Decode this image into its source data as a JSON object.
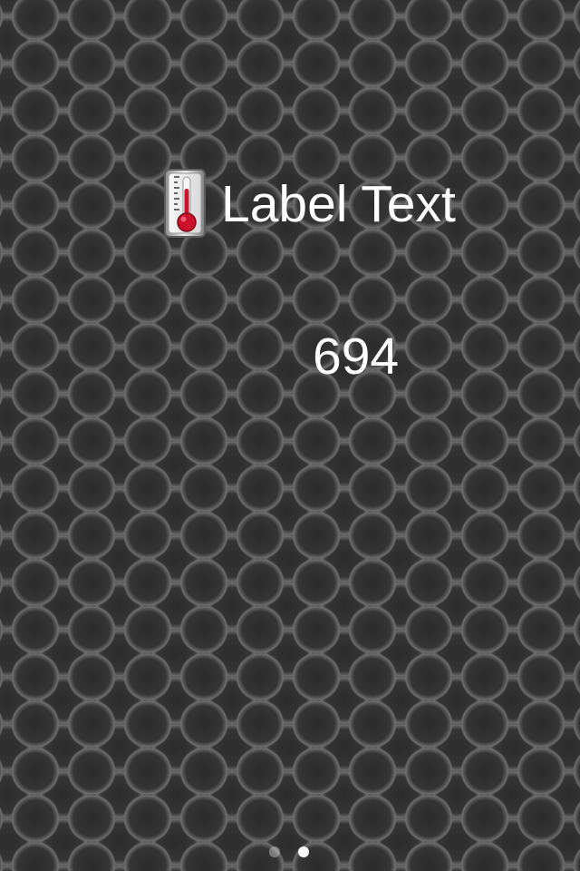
{
  "screen": {
    "title_label": "Label Text",
    "value": "694",
    "icon": "thermometer-icon",
    "accent_color": "#c8102e"
  },
  "pager": {
    "pages": 2,
    "active_page": 2
  }
}
